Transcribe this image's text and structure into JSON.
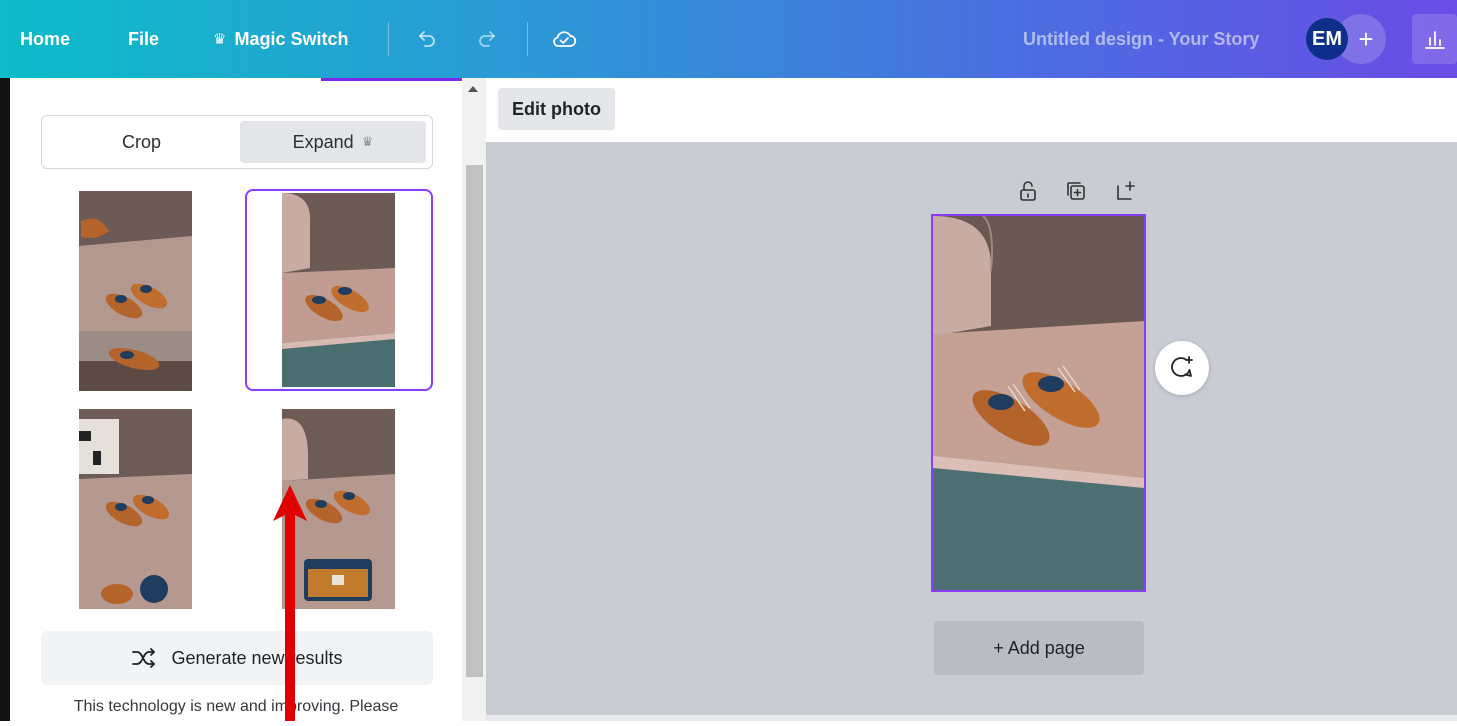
{
  "topbar": {
    "home_label": "Home",
    "file_label": "File",
    "magic_switch_label": "Magic Switch",
    "magic_switch_icon": "crown-icon",
    "undo_icon": "undo-icon",
    "redo_icon": "redo-icon",
    "save_status_icon": "cloud-check-icon",
    "document_title": "Untitled design - Your Story",
    "avatar_initials": "EM",
    "add_collaborator_label": "+",
    "stats_icon": "bar-chart-icon",
    "gradient_colors": [
      "#0cbcc8",
      "#6a4ce6"
    ]
  },
  "panel": {
    "crop_label": "Crop",
    "expand_label": "Expand",
    "expand_icon": "crown-icon",
    "results": [
      {
        "name": "expand-result-1",
        "selected": false
      },
      {
        "name": "expand-result-2",
        "selected": true
      },
      {
        "name": "expand-result-3",
        "selected": false
      },
      {
        "name": "expand-result-4",
        "selected": false
      }
    ],
    "generate_label": "Generate new results",
    "generate_icon": "shuffle-icon",
    "disclaimer": "This technology is new and improving. Please"
  },
  "editor": {
    "edit_photo_label": "Edit photo",
    "page_icons": [
      "lock-icon",
      "duplicate-icon",
      "add-page-icon"
    ],
    "comment_icon": "add-comment-icon",
    "add_page_label": "+ Add page",
    "accent_color": "#8b3dff",
    "canvas_bg": "#c9ccd3"
  },
  "annotation": {
    "arrow_color": "#e00000",
    "arrow_icon": "red-arrow-icon"
  }
}
